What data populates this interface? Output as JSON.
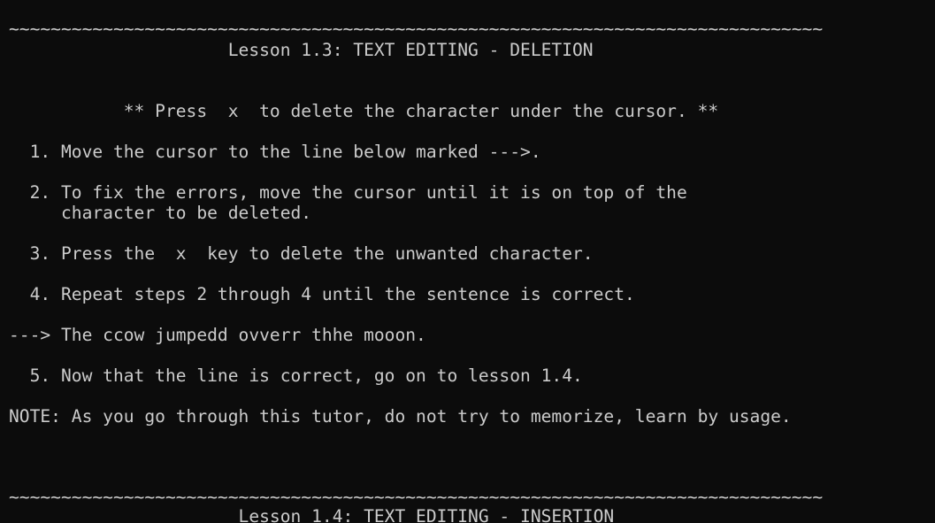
{
  "terminal": {
    "background": "#0c0c0c",
    "foreground": "#cccccc",
    "lines": [
      {
        "row": 0,
        "text": "~~~~~~~~~~~~~~~~~~~~~~~~~~~~~~~~~~~~~~~~~~~~~~~~~~~~~~~~~~~~~~~~~~~~~~~~~~~~~~"
      },
      {
        "row": 1,
        "text": "                     Lesson 1.3: TEXT EDITING - DELETION"
      },
      {
        "row": 4,
        "text": "           ** Press  x  to delete the character under the cursor. **"
      },
      {
        "row": 6,
        "text": "  1. Move the cursor to the line below marked --->."
      },
      {
        "row": 8,
        "text": "  2. To fix the errors, move the cursor until it is on top of the"
      },
      {
        "row": 9,
        "text": "     character to be deleted."
      },
      {
        "row": 11,
        "text": "  3. Press the  x  key to delete the unwanted character."
      },
      {
        "row": 13,
        "text": "  4. Repeat steps 2 through 4 until the sentence is correct."
      },
      {
        "row": 15,
        "text": "---> The ccow jumpedd ovverr thhe mooon."
      },
      {
        "row": 17,
        "text": "  5. Now that the line is correct, go on to lesson 1.4."
      },
      {
        "row": 19,
        "text": "NOTE: As you go through this tutor, do not try to memorize, learn by usage."
      },
      {
        "row": 23,
        "text": "~~~~~~~~~~~~~~~~~~~~~~~~~~~~~~~~~~~~~~~~~~~~~~~~~~~~~~~~~~~~~~~~~~~~~~~~~~~~~~"
      },
      {
        "row": 24,
        "text": "                      Lesson 1.4: TEXT EDITING - INSERTION"
      }
    ]
  }
}
